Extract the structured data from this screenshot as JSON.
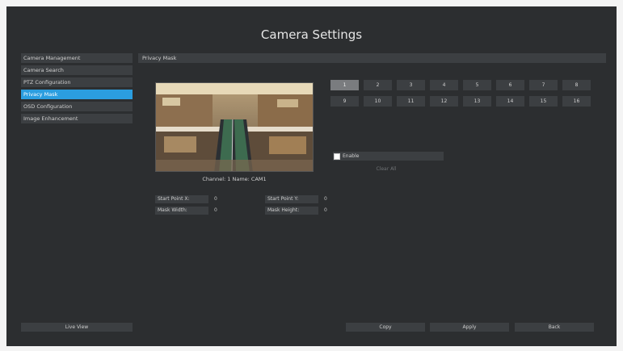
{
  "window": {
    "title": "Camera Settings"
  },
  "sidebar": {
    "items": [
      {
        "label": "Camera Management",
        "active": false
      },
      {
        "label": "Camera Search",
        "active": false
      },
      {
        "label": "PTZ Configuration",
        "active": false
      },
      {
        "label": "Privacy Mask",
        "active": true
      },
      {
        "label": "OSD Configuration",
        "active": false
      },
      {
        "label": "Image Enhancement",
        "active": false
      }
    ],
    "live_view_label": "Live View"
  },
  "main": {
    "section_title": "Privacy Mask",
    "preview": {
      "channel_label": "Channel: 1  Name: CAM1"
    },
    "mask_areas": [
      "1",
      "2",
      "3",
      "4",
      "5",
      "6",
      "7",
      "8",
      "9",
      "10",
      "11",
      "12",
      "13",
      "14",
      "15",
      "16"
    ],
    "selected_mask": "1",
    "enable_label": "Enable",
    "clear_all_label": "Clear All",
    "fields": {
      "start_x": {
        "label": "Start Point X:",
        "value": "0"
      },
      "start_y": {
        "label": "Start Point Y:",
        "value": "0"
      },
      "mask_width": {
        "label": "Mask Width:",
        "value": "0"
      },
      "mask_height": {
        "label": "Mask Height:",
        "value": "0"
      }
    }
  },
  "footer": {
    "copy_label": "Copy",
    "apply_label": "Apply",
    "back_label": "Back"
  },
  "colors": {
    "accent": "#2b9ee0",
    "panel": "#2c2e30",
    "control": "#3c3f42"
  }
}
